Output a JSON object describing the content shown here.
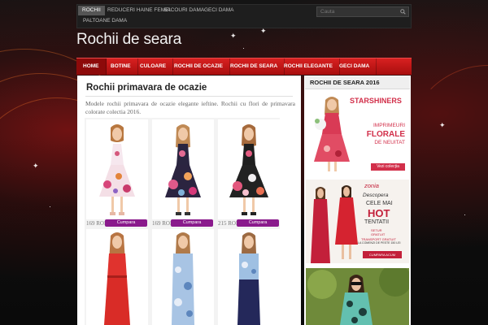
{
  "topbar": {
    "nav": [
      "ROCHII",
      "REDUCERI HAINE FEMEI",
      "SACOURI DAMA",
      "GECI DAMA",
      "PALTOANE DAMA"
    ],
    "search_placeholder": "Cauta"
  },
  "site_title": "Rochii de seara",
  "main_nav": [
    "HOME",
    "BOTINE",
    "CULOARE",
    "ROCHII DE OCAZIE",
    "ROCHII DE SEARA",
    "ROCHII ELEGANTE",
    "GECI DAMA"
  ],
  "post": {
    "title": "Rochii primavara de ocazie",
    "text": "Modele rochii primavara de ocazie elegante ieftine. Rochii cu flori de primavara colorate colectia 2016.",
    "products": [
      {
        "price": "169 RON",
        "button": "Cumpara"
      },
      {
        "price": "169 RON",
        "button": "Cumpara"
      },
      {
        "price": "215 RON",
        "button": "Cumpara"
      },
      {
        "price": "",
        "button": ""
      },
      {
        "price": "",
        "button": ""
      },
      {
        "price": "",
        "button": ""
      }
    ]
  },
  "sidebar": {
    "widget_title": "ROCHII DE SEARA 2016",
    "ad1": {
      "brand": "STARSHINERS",
      "line1": "IMPRIMEURI",
      "line2": "FLORALE",
      "line3": "DE NEUITAT",
      "cta": "Vezi colecția"
    },
    "ad2": {
      "brand": "zonia",
      "line1": "Descopera",
      "line2": "CELE MAI",
      "line3": "HOT",
      "line4": "TENTATII",
      "line5": "SETUR",
      "line6": "GRATUIT",
      "line7": "TRANSPORT GRATUIT",
      "line8": "LA COMENZI DE PESTE 150 LEI",
      "cta": "CUMPARA ACUM"
    }
  },
  "colors": {
    "nav_red": "#c81818",
    "buy_purple": "#8a1a8c",
    "page_bg": "#0c0c0c"
  },
  "icons": {
    "search": "search-icon",
    "sparkle": "sparkle-icon"
  }
}
